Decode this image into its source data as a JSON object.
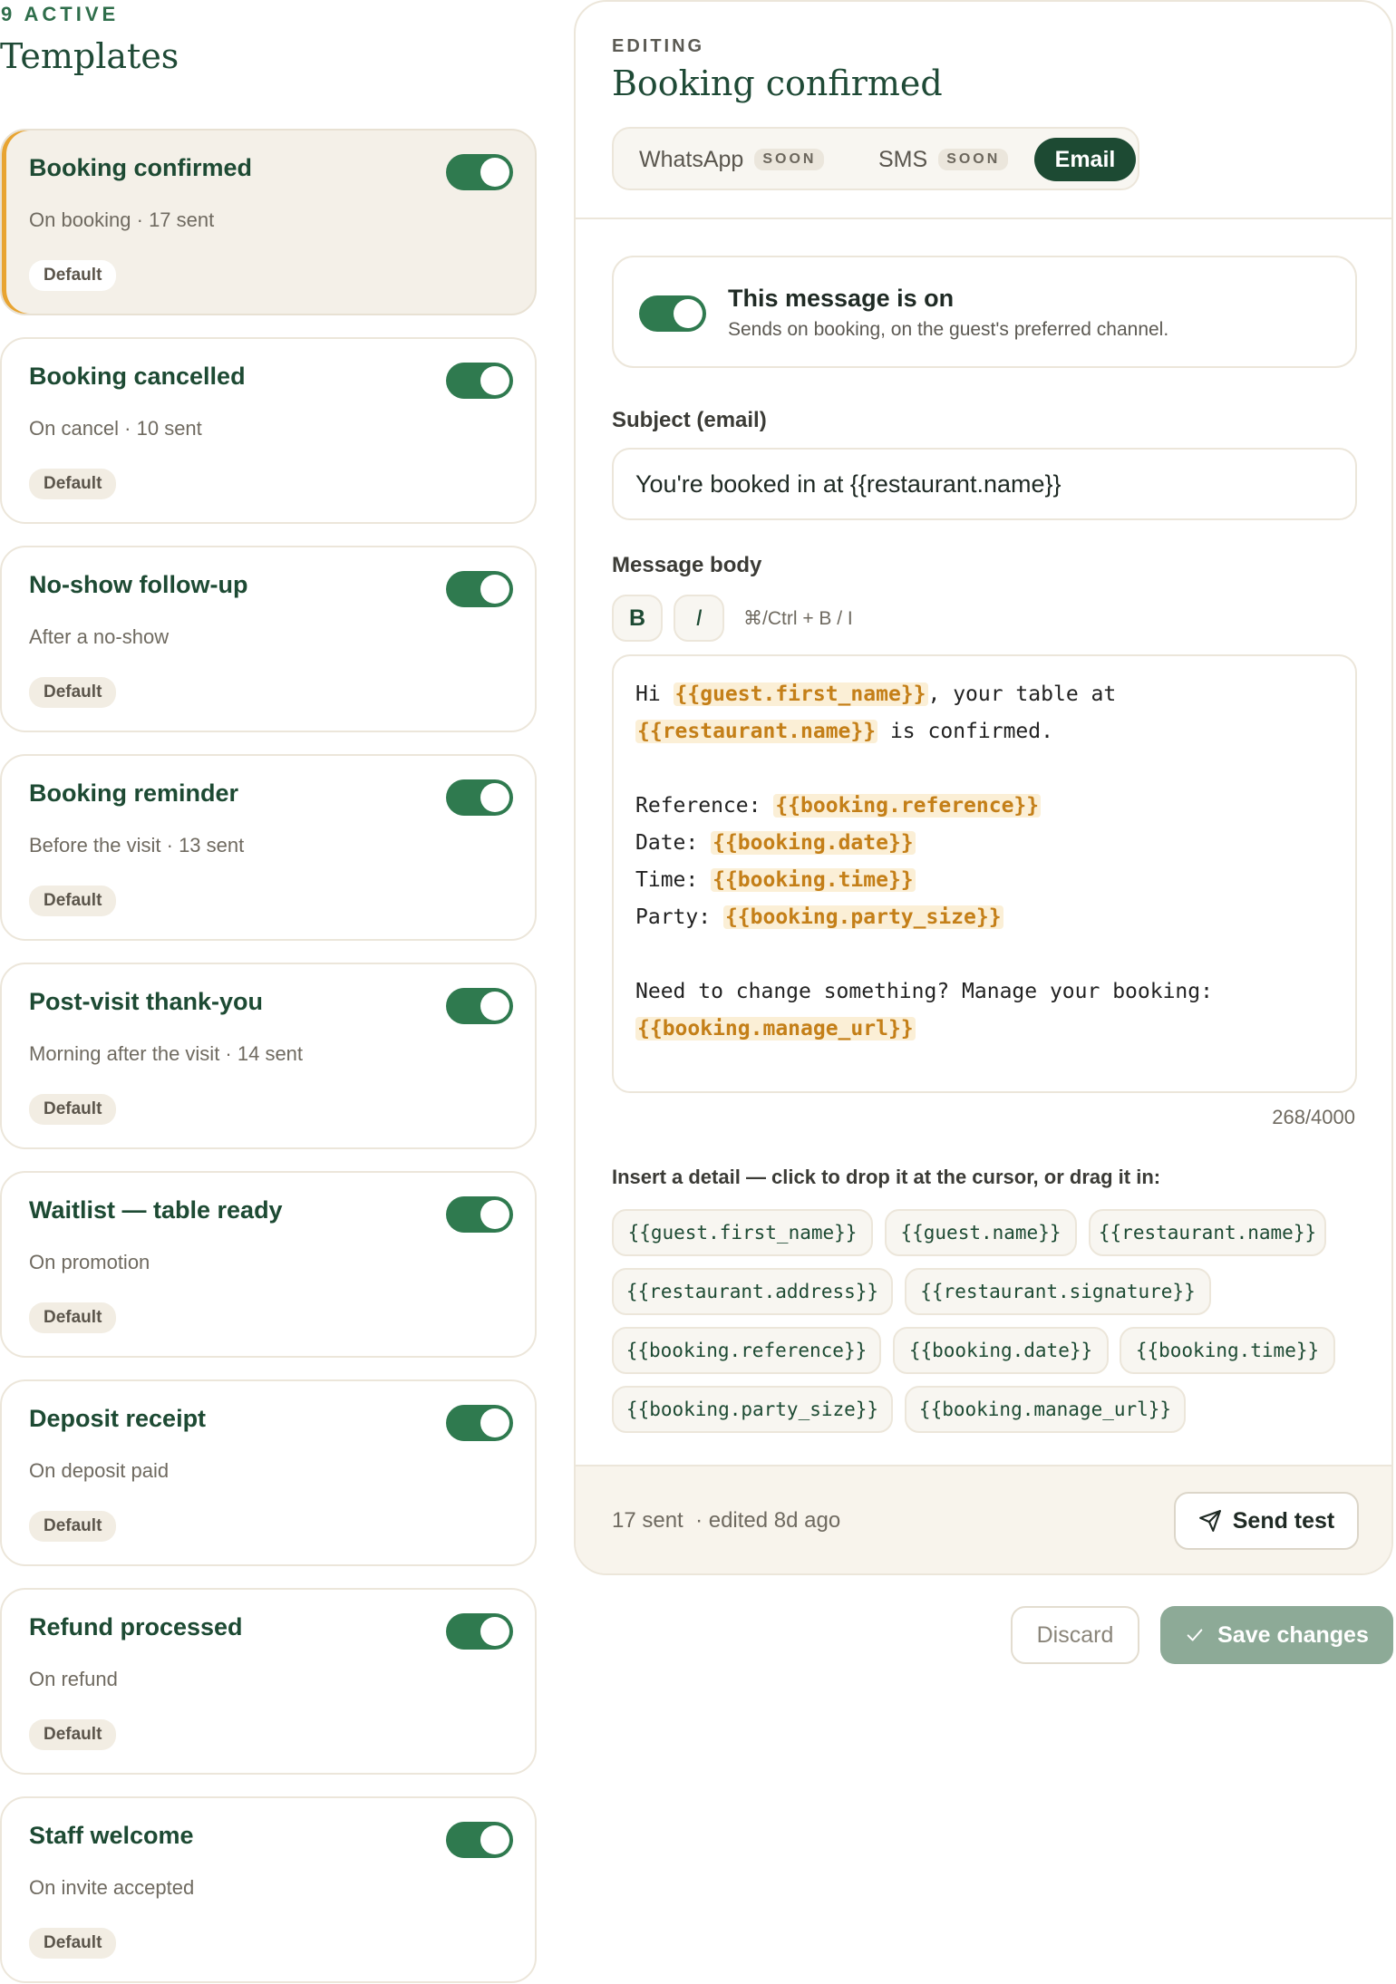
{
  "sidebar": {
    "active_count_label": "9 ACTIVE",
    "title": "Templates",
    "templates": [
      {
        "title": "Booking confirmed",
        "sub": "On booking · 17 sent",
        "badge": "Default",
        "enabled": true
      },
      {
        "title": "Booking cancelled",
        "sub": "On cancel · 10 sent",
        "badge": "Default",
        "enabled": true
      },
      {
        "title": "No-show follow-up",
        "sub": "After a no-show",
        "badge": "Default",
        "enabled": true
      },
      {
        "title": "Booking reminder",
        "sub": "Before the visit · 13 sent",
        "badge": "Default",
        "enabled": true
      },
      {
        "title": "Post-visit thank-you",
        "sub": "Morning after the visit · 14 sent",
        "badge": "Default",
        "enabled": true
      },
      {
        "title": "Waitlist — table ready",
        "sub": "On promotion",
        "badge": "Default",
        "enabled": true
      },
      {
        "title": "Deposit receipt",
        "sub": "On deposit paid",
        "badge": "Default",
        "enabled": true
      },
      {
        "title": "Refund processed",
        "sub": "On refund",
        "badge": "Default",
        "enabled": true
      },
      {
        "title": "Staff welcome",
        "sub": "On invite accepted",
        "badge": "Default",
        "enabled": true
      }
    ]
  },
  "editor": {
    "editing_label": "EDITING",
    "title": "Booking confirmed",
    "tabs": [
      {
        "label": "WhatsApp",
        "badge": "SOON"
      },
      {
        "label": "SMS",
        "badge": "SOON"
      },
      {
        "label": "Email",
        "badge": ""
      }
    ],
    "message_on": {
      "title": "This message is on",
      "sub": "Sends on booking, on the guest's preferred channel."
    },
    "subject_label": "Subject (email)",
    "subject_value": "You're booked in at {{restaurant.name}}",
    "body_label": "Message body",
    "bold_label": "B",
    "italic_label": "I",
    "format_hint": "⌘/Ctrl + B / I",
    "body": {
      "l1a": "Hi ",
      "l1v": "{{guest.first_name}}",
      "l1b": ", your table at",
      "l2v": "{{restaurant.name}}",
      "l2b": " is confirmed.",
      "l3a": "Reference: ",
      "l3v": "{{booking.reference}}",
      "l4a": "Date: ",
      "l4v": "{{booking.date}}",
      "l5a": "Time: ",
      "l5v": "{{booking.time}}",
      "l6a": "Party: ",
      "l6v": "{{booking.party_size}}",
      "l7a": "Need to change something? Manage your booking:",
      "l8v": "{{booking.manage_url}}"
    },
    "char_count": "268/4000",
    "insert_label": "Insert a detail — click to drop it at the cursor, or drag it in:",
    "chips": [
      "{{guest.first_name}}",
      "{{guest.name}}",
      "{{restaurant.name}}",
      "{{restaurant.address}}",
      "{{restaurant.signature}}",
      "{{booking.reference}}",
      "{{booking.date}}",
      "{{booking.time}}",
      "{{booking.party_size}}",
      "{{booking.manage_url}}"
    ],
    "footer_meta": "17 sent  · edited 8d ago",
    "send_test_label": "Send test"
  },
  "actions": {
    "discard_label": "Discard",
    "save_label": "Save changes"
  },
  "colors": {
    "accent_green": "#1d4a33",
    "toggle_green": "#2f7a4f",
    "highlight_amber": "#e8a431"
  }
}
